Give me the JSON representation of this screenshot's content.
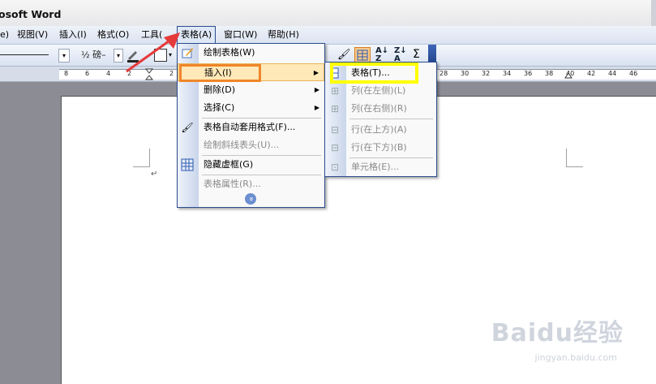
{
  "window": {
    "title": "osoft Word"
  },
  "menubar": {
    "items": [
      {
        "label": "e)"
      },
      {
        "label": "视图(V)"
      },
      {
        "label": "插入(I)"
      },
      {
        "label": "格式(O)"
      },
      {
        "label": "工具("
      },
      {
        "label": "表格(A)"
      },
      {
        "label": "窗口(W)"
      },
      {
        "label": "帮助(H)"
      }
    ]
  },
  "toolbar": {
    "font_size": "½ 磅–"
  },
  "ruler": {
    "left_ticks": [
      "8",
      "6",
      "4",
      "2",
      "2"
    ],
    "right_ticks": [
      "28",
      "30",
      "32",
      "34",
      "36",
      "38",
      "40",
      "42",
      "44",
      "46"
    ]
  },
  "table_menu": {
    "items": [
      {
        "label": "绘制表格(W)"
      },
      {
        "label": "插入(I)"
      },
      {
        "label": "删除(D)"
      },
      {
        "label": "选择(C)"
      },
      {
        "label": "表格自动套用格式(F)..."
      },
      {
        "label": "绘制斜线表头(U)..."
      },
      {
        "label": "隐藏虚框(G)"
      },
      {
        "label": "表格属性(R)..."
      }
    ],
    "expand": "»"
  },
  "insert_submenu": {
    "items": [
      {
        "label": "表格(T)..."
      },
      {
        "label": "列(在左侧)(L)"
      },
      {
        "label": "列(在右侧)(R)"
      },
      {
        "label": "行(在上方)(A)"
      },
      {
        "label": "行(在下方)(B)"
      },
      {
        "label": "单元格(E)..."
      }
    ]
  },
  "watermark": {
    "brand": "Baidu经验",
    "url": "jingyan.baidu.com"
  },
  "colors": {
    "highlight_orange": "#f0862a",
    "highlight_yellow": "#ffff00",
    "arrow_red": "#e53a3a",
    "menu_border": "#2c4d8c"
  }
}
